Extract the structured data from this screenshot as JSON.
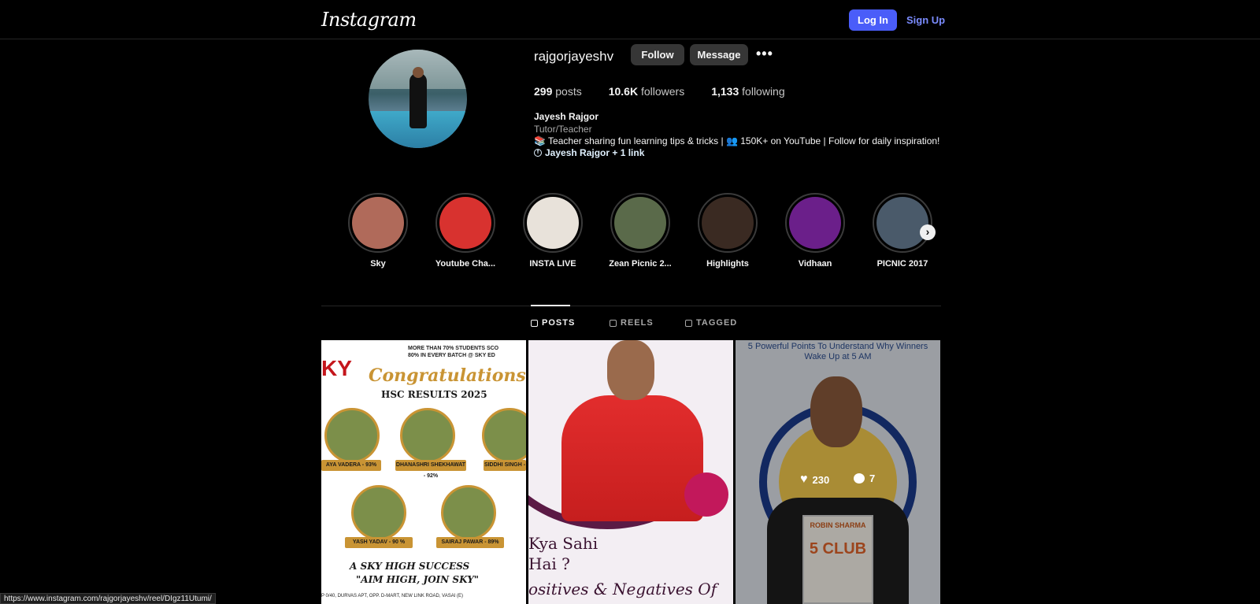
{
  "nav": {
    "logo": "Instagram",
    "login": "Log In",
    "signup": "Sign Up"
  },
  "profile": {
    "username": "rajgorjayeshv",
    "follow": "Follow",
    "message": "Message",
    "more": "•••",
    "stats": {
      "posts_count": "299",
      "posts_label": "posts",
      "followers_count": "10.6K",
      "followers_label": "followers",
      "following_count": "1,133",
      "following_label": "following"
    },
    "full_name": "Jayesh Rajgor",
    "category": "Tutor/Teacher",
    "bio": "📚 Teacher sharing fun learning tips & tricks | 👥 150K+ on YouTube | Follow for daily inspiration!",
    "link": "Jayesh Rajgor + 1 link"
  },
  "highlights": [
    {
      "label": "Sky",
      "color": "#b06a5a"
    },
    {
      "label": "Youtube Cha...",
      "color": "#d8322f"
    },
    {
      "label": "INSTA LIVE",
      "color": "#e8e2da"
    },
    {
      "label": "Zean Picnic 2...",
      "color": "#5a6a4a"
    },
    {
      "label": "Highlights",
      "color": "#3a2a22"
    },
    {
      "label": "Vidhaan",
      "color": "#6b1f8a"
    },
    {
      "label": "PICNIC 2017",
      "color": "#4a5a6a"
    }
  ],
  "tabs": {
    "posts": "POSTS",
    "reels": "REELS",
    "tagged": "TAGGED"
  },
  "posts": {
    "p1": {
      "top_text": "MORE THAN 70% STUDENTS SCO\n80% IN EVERY BATCH @ SKY ED",
      "congrats": "Congratulations!",
      "heading": "HSC RESULTS 2025",
      "names": [
        "AYA VADERA - 93%",
        "DHANASHRI SHEKHAWAT - 92%",
        "SIDDHI SINGH -",
        "YASH YADAV - 90 %",
        "SAIRAJ PAWAR - 89%"
      ],
      "success": "A SKY HIGH SUCCESS",
      "aim": "\"AIM HIGH, JOIN SKY\"",
      "address": "P 0/40, DURVAS APT, OPP. D-MART, NEW LINK ROAD, VASAI (E)"
    },
    "p2": {
      "line1": "Kya Sahi",
      "line2": "Hai ?",
      "line3": "ositives & Negatives Of"
    },
    "p3": {
      "headline": "5 Powerful Points To Understand Why Winners Wake Up at 5 AM",
      "book_author": "ROBIN SHARMA",
      "book_title": "5 CLUB",
      "likes": "230",
      "comments": "7"
    }
  },
  "status_url": "https://www.instagram.com/rajgorjayeshv/reel/DIgz11Utumi/"
}
